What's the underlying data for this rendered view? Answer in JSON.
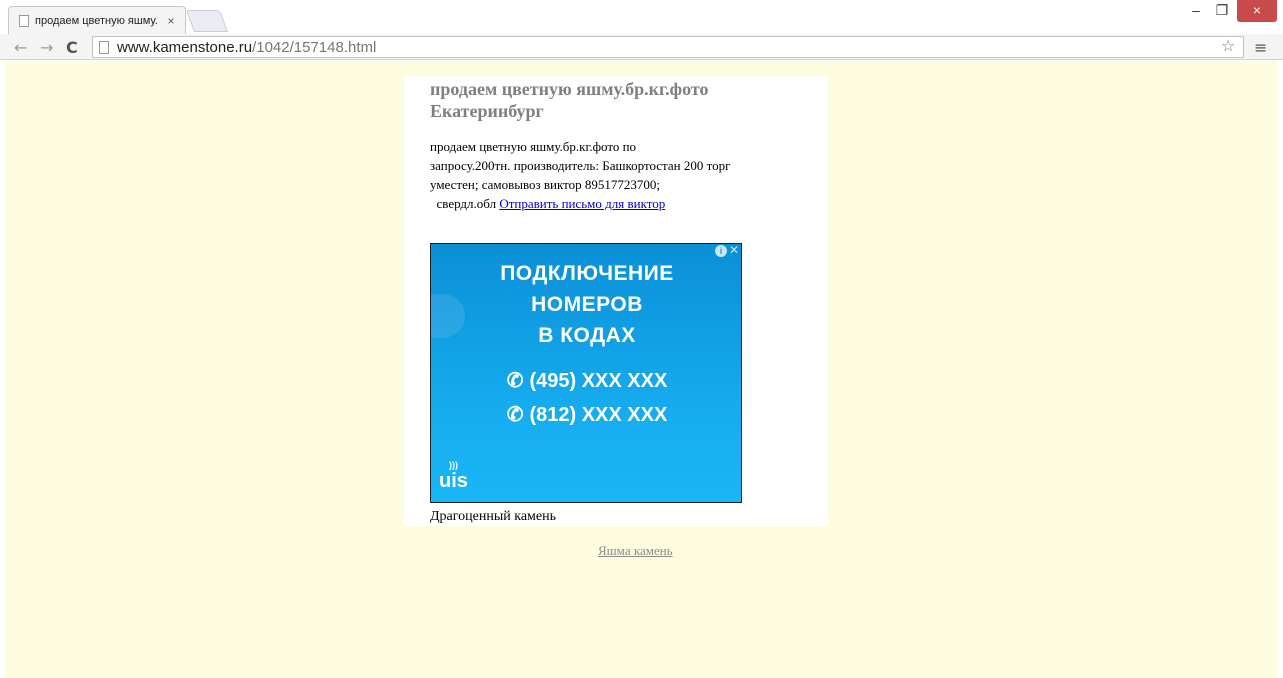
{
  "browser": {
    "tab_title": "продаем цветную яшму.",
    "tab_close": "×",
    "url_host": "www.kamenstone.ru",
    "url_path": "/1042/157148.html",
    "window_controls": {
      "minimize": "–",
      "maximize": "❐",
      "close": "×"
    },
    "nav": {
      "back": "←",
      "forward": "→",
      "reload": "C"
    },
    "star": "☆",
    "menu": "≡"
  },
  "page": {
    "heading": "продаем цветную яшму.бр.кг.фото Екатеринбург",
    "body_line1": "продаем цветную яшму.бр.кг.фото по",
    "body_line2": "запросу.200тн.  производитель: Башкортостан 200 торг",
    "body_line3": "уместен;   самовывоз виктор    89517723700;",
    "body_line4_prefix": "  свердл.обл ",
    "email_link": "Отправить письмо для виктор",
    "caption": "Драгоценный камень",
    "footer_link": "Яшма камень",
    "background_color": "#fdfcdf"
  },
  "ad": {
    "info": "i",
    "close": "✕",
    "headline_1": "ПОДКЛЮЧЕНИЕ",
    "headline_2": "НОМЕРОВ",
    "headline_3": "В КОДАХ",
    "phone_1": "(495) XXX XXX",
    "phone_2": "(812) XXX XXX",
    "phone_icon": "✆",
    "logo": "uis",
    "logo_wave": ")))",
    "colors": {
      "top": "#0b8fd6",
      "bottom": "#19b6f5"
    }
  }
}
